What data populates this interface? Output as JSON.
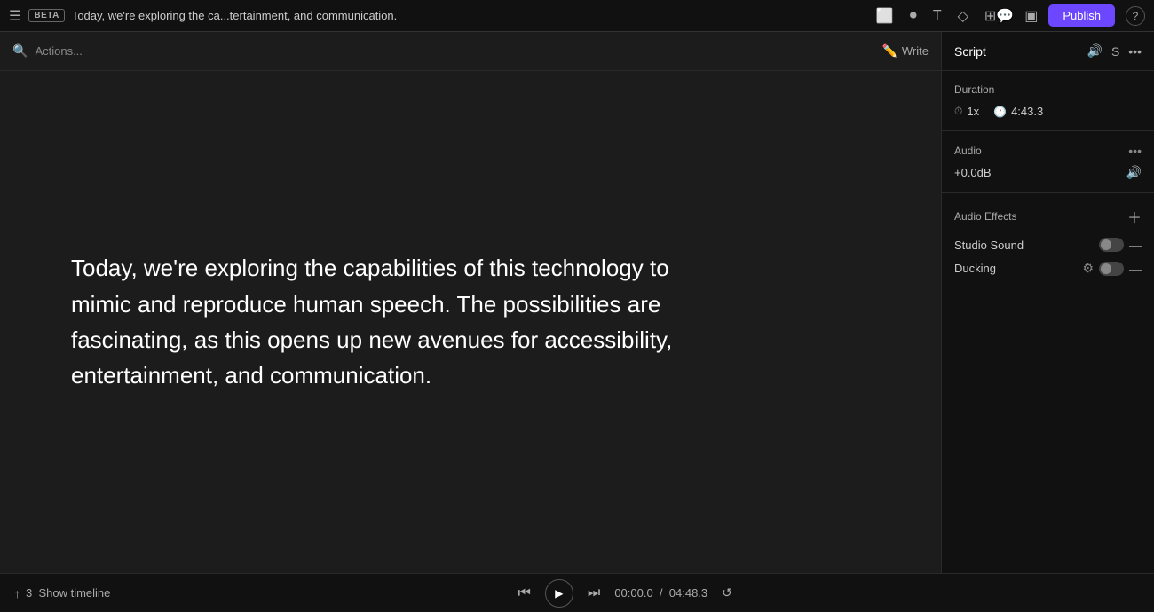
{
  "topbar": {
    "beta_label": "BETA",
    "title": "Today, we're exploring the ca...tertainment, and communication.",
    "publish_label": "Publish",
    "help_label": "?"
  },
  "left": {
    "actions_label": "Actions...",
    "write_label": "Write",
    "canvas_text": "Today, we're exploring the capabilities of this technology to mimic and reproduce human speech. The possibilities are fascinating, as this opens up new avenues for accessibility, entertainment, and communication."
  },
  "right_panel": {
    "script_label": "Script",
    "s_label": "S",
    "duration": {
      "title": "Duration",
      "speed": "1x",
      "time": "4:43.3"
    },
    "audio": {
      "title": "Audio",
      "value": "+0.0dB"
    },
    "effects": {
      "title": "Audio Effects",
      "items": [
        {
          "name": "Studio Sound"
        },
        {
          "name": "Ducking"
        }
      ]
    }
  },
  "bottom": {
    "show_timeline_label": "Show timeline",
    "timeline_number": "3",
    "time_current": "00:00.0",
    "separator": "/",
    "time_total": "04:48.3"
  }
}
